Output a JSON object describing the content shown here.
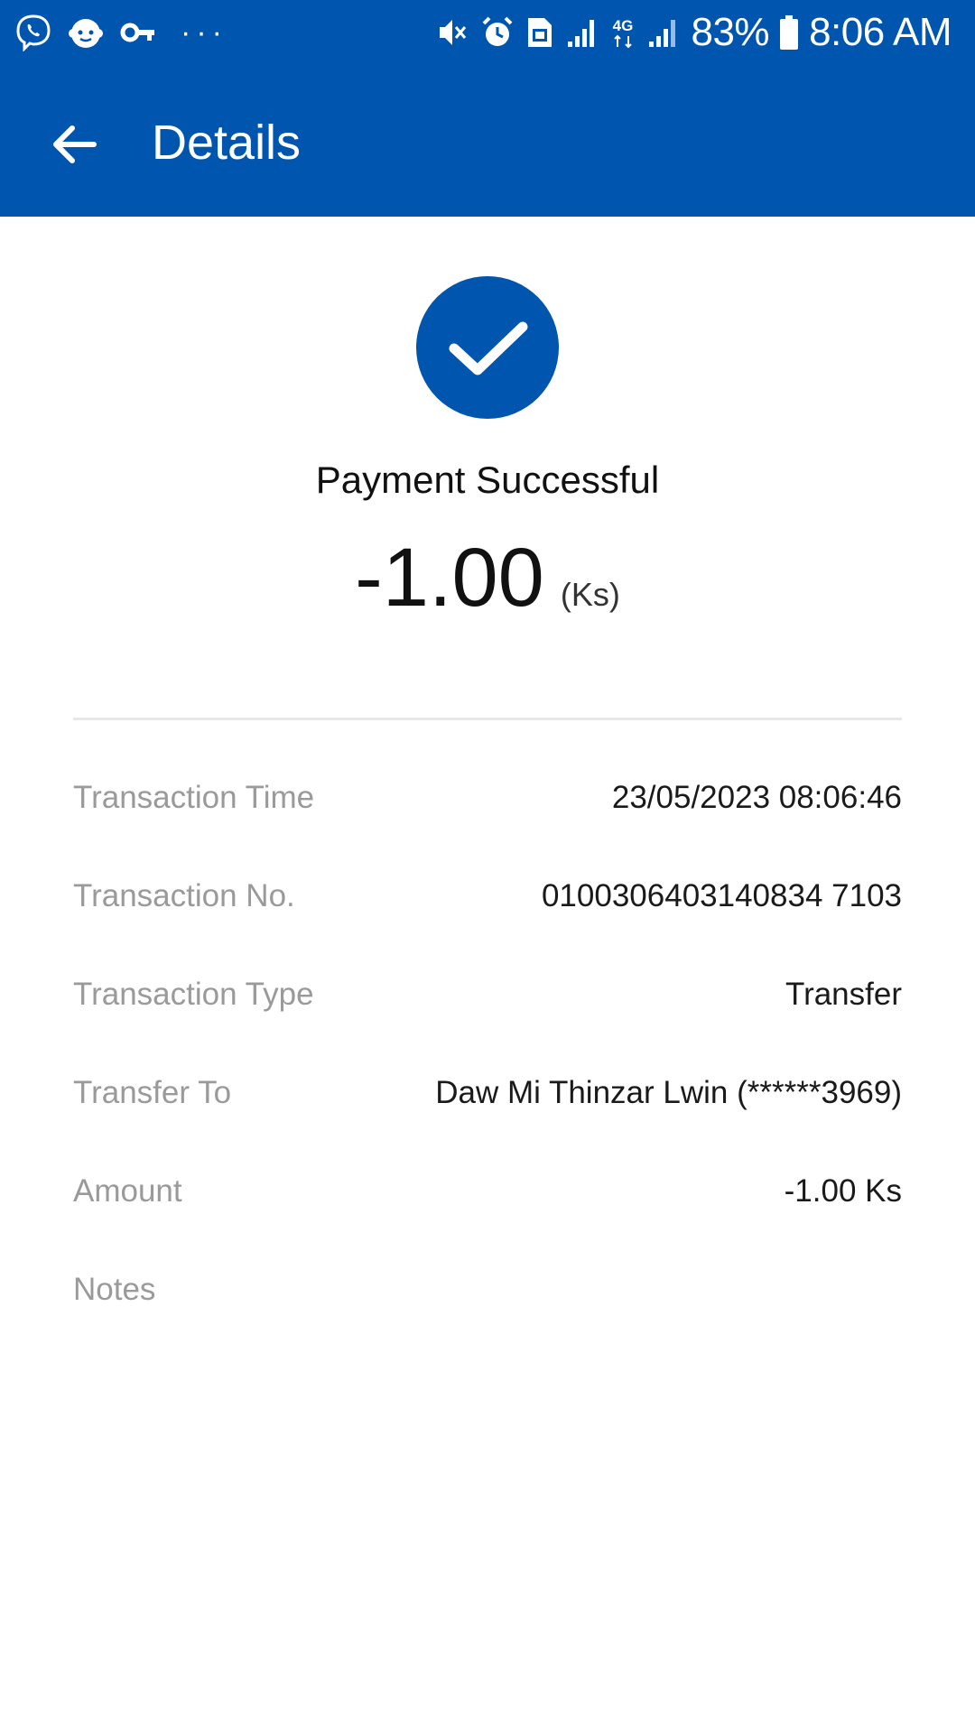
{
  "status_bar": {
    "battery": "83%",
    "time": "8:06 AM",
    "network": "4G",
    "left_icons": [
      "viber-icon",
      "baby-face-icon",
      "vpn-key-icon",
      "more-dots-icon"
    ],
    "right_icons": [
      "vibrate-mute-icon",
      "alarm-icon",
      "sim-icon",
      "signal-icon",
      "network-4g-icon",
      "signal-icon",
      "battery-icon"
    ]
  },
  "toolbar": {
    "title": "Details",
    "back_icon": "arrow-left-icon"
  },
  "result": {
    "icon": "check-circle-icon",
    "message": "Payment Successful",
    "amount": "-1.00",
    "unit": "(Ks)"
  },
  "details": [
    {
      "label": "Transaction Time",
      "value": "23/05/2023 08:06:46"
    },
    {
      "label": "Transaction No.",
      "value": "0100306403140834 7103"
    },
    {
      "label": "Transaction Type",
      "value": "Transfer"
    },
    {
      "label": "Transfer To",
      "value": "Daw Mi Thinzar Lwin (******3969)"
    },
    {
      "label": "Amount",
      "value": "-1.00 Ks"
    },
    {
      "label": "Notes",
      "value": ""
    }
  ],
  "colors": {
    "primary": "#0055AE",
    "label_gray": "#9a9a9a",
    "text_dark": "#1a1a1a",
    "background": "#ffffff"
  }
}
